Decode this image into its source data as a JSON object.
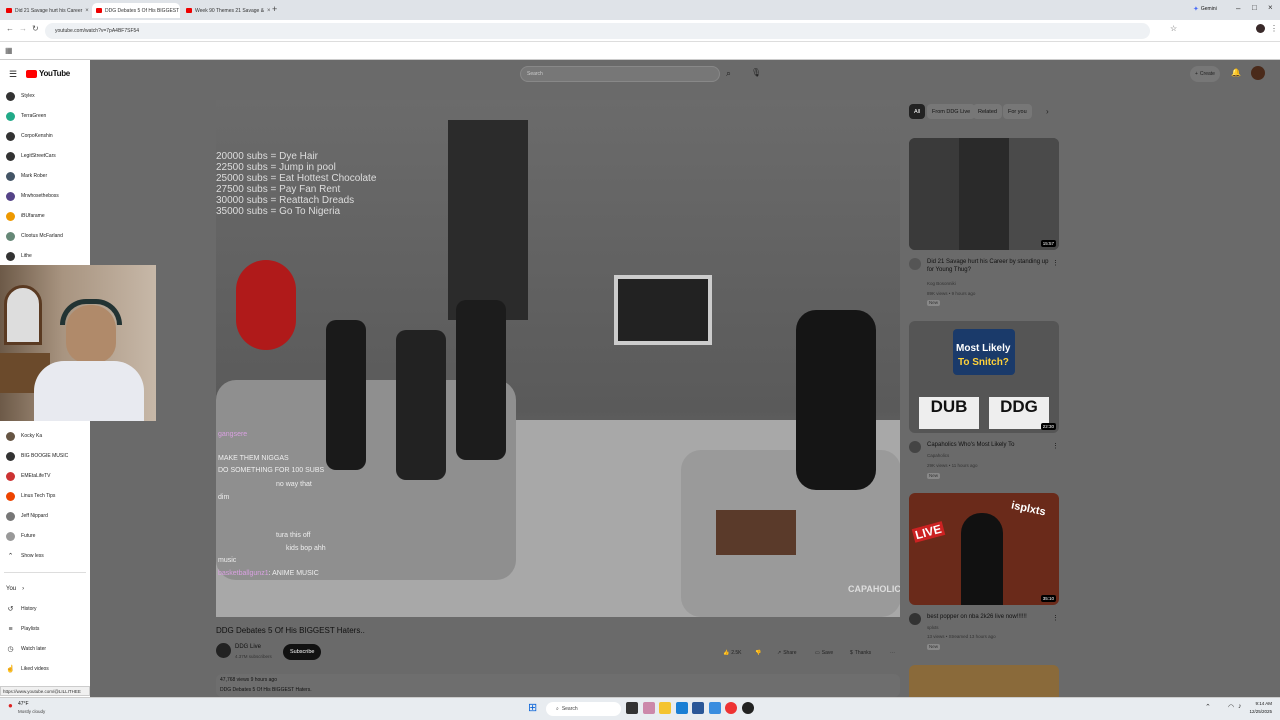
{
  "browser": {
    "tabs": [
      {
        "label": "Did 21 Savage hurt his Career"
      },
      {
        "label": "DDG Debates 5 Of His BIGGEST"
      },
      {
        "label": "Week 90 Themes 21 Savage &"
      }
    ],
    "profile_label": "Gemini",
    "url": "youtube.com/watch?v=7pA4BF7SF54"
  },
  "youtube": {
    "logo_text": "YouTube",
    "search_placeholder": "Search",
    "create_label": "Create",
    "subscriptions": [
      {
        "label": "Stylex"
      },
      {
        "label": "TerraGreen"
      },
      {
        "label": "CorpoKenshin"
      },
      {
        "label": "LegitStreetCars"
      },
      {
        "label": "Mark Rober"
      },
      {
        "label": "Mrwhosetheboss"
      },
      {
        "label": "iBUfarame"
      },
      {
        "label": "Clootus McFarland"
      },
      {
        "label": "Lithe"
      }
    ],
    "subscriptions_lower": [
      {
        "label": "Kocky Ka"
      },
      {
        "label": "BIG BOOGIE MUSIC"
      },
      {
        "label": "EMEtaLifeTV"
      },
      {
        "label": "Linus Tech Tips"
      },
      {
        "label": "Jeff Nippard"
      },
      {
        "label": "Future"
      },
      {
        "label": "Show less"
      }
    ],
    "you_section": {
      "heading": "You",
      "items": [
        {
          "label": "History"
        },
        {
          "label": "Playlists"
        },
        {
          "label": "Watch later"
        },
        {
          "label": "Liked videos"
        }
      ]
    },
    "status_url": "https://www.youtube.com/@LILLITHEE",
    "video": {
      "subs_overlay": [
        "20000 subs = Dye Hair",
        "22500 subs = Jump in pool",
        "25000 subs = Eat Hottest Chocolate",
        "27500 subs = Pay Fan Rent",
        "30000 subs = Reattach Dreads",
        "35000 subs = Go To Nigeria"
      ],
      "chat": [
        {
          "user": "gangsere",
          "text": ""
        },
        {
          "user": "",
          "text": "MAKE THEM NIGGAS"
        },
        {
          "user": "",
          "text": "DO SOMETHING FOR 100 SUBS"
        },
        {
          "user": "",
          "text": "no way that"
        },
        {
          "user": "",
          "text": "dim"
        },
        {
          "user": "",
          "text": ""
        },
        {
          "user": "",
          "text": ""
        },
        {
          "user": "",
          "text": "tura this off"
        },
        {
          "user": "",
          "text": "kids bop ahh"
        },
        {
          "user": "",
          "text": "music"
        },
        {
          "user": "basketballgunz1",
          "text": "ANIME MUSIC"
        },
        {
          "user": "",
          "text": ""
        }
      ],
      "watermark": "CAPAHOLICS",
      "title": "DDG Debates 5 Of His BIGGEST Haters..",
      "channel": "DDG Live",
      "subscribers": "4.37M subscribers",
      "subscribe_label": "Subscribe",
      "likes": "2.5K",
      "share_label": "Share",
      "save_label": "Save",
      "thanks_label": "Thanks",
      "views": "47,768 views  9 hours ago",
      "description": "DDG Debates 5 Of His BIGGEST Haters."
    },
    "chips": [
      {
        "label": "All"
      },
      {
        "label": "From DDG Live"
      },
      {
        "label": "Related"
      },
      {
        "label": "For you"
      }
    ],
    "recommendations": [
      {
        "title": "Did 21 Savage hurt his Career by standing up for Young Thug?",
        "channel": "Kog Bosonniki",
        "meta": "89K views • 9 hours ago",
        "badge": "New",
        "duration": "15:57"
      },
      {
        "title": "Capaholics Who's Most Likely To",
        "channel": "Capaholics",
        "meta": "29K views • 11 hours ago",
        "badge": "New",
        "duration": "22:30",
        "thumb_text": [
          "Most Likely",
          "To Snitch?",
          "DUB",
          "DDG"
        ]
      },
      {
        "title": "best popper on nba 2k26 live now!!!!!!",
        "channel": "splxts",
        "meta": "13 views • Streamed 13 hours ago",
        "badge": "New",
        "duration": "35:10",
        "thumb_text": [
          "LIVE",
          "isplxts"
        ]
      }
    ]
  },
  "taskbar": {
    "weather_temp": "47°F",
    "weather_desc": "Mostly cloudy",
    "search_label": "Search",
    "time": "9:14 AM",
    "date": "12/25/2025"
  }
}
